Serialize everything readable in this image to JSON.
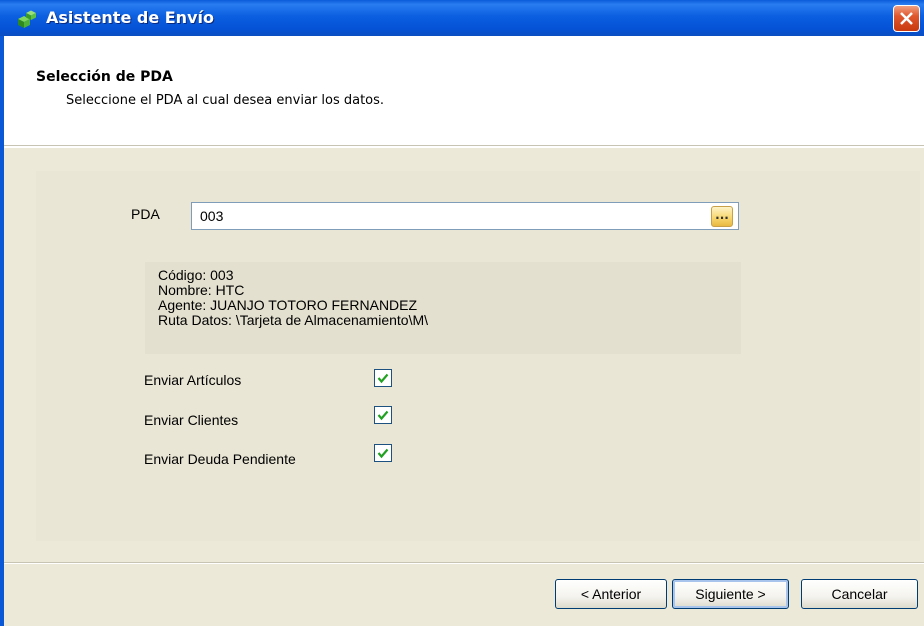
{
  "window": {
    "title": "Asistente de Envío",
    "icon": "green-cubes-icon"
  },
  "header": {
    "title": "Selección de PDA",
    "subtitle": "Seleccione el PDA al cual desea enviar los datos."
  },
  "pda": {
    "label": "PDA",
    "value": "003",
    "browse_label": "..."
  },
  "info": {
    "codigo": "Código: 003",
    "nombre": "Nombre: HTC",
    "agente": "Agente: JUANJO TOTORO FERNANDEZ",
    "ruta": "Ruta Datos: \\Tarjeta de Almacenamiento\\M\\"
  },
  "options": [
    {
      "label": "Enviar Artículos",
      "checked": true
    },
    {
      "label": "Enviar Clientes",
      "checked": true
    },
    {
      "label": "Enviar Deuda Pendiente",
      "checked": true
    }
  ],
  "buttons": {
    "anterior": "< Anterior",
    "siguiente": "Siguiente >",
    "cancelar": "Cancelar"
  },
  "colors": {
    "titlebar": "#0552d6",
    "background": "#ece9d8",
    "check": "#21a121"
  }
}
